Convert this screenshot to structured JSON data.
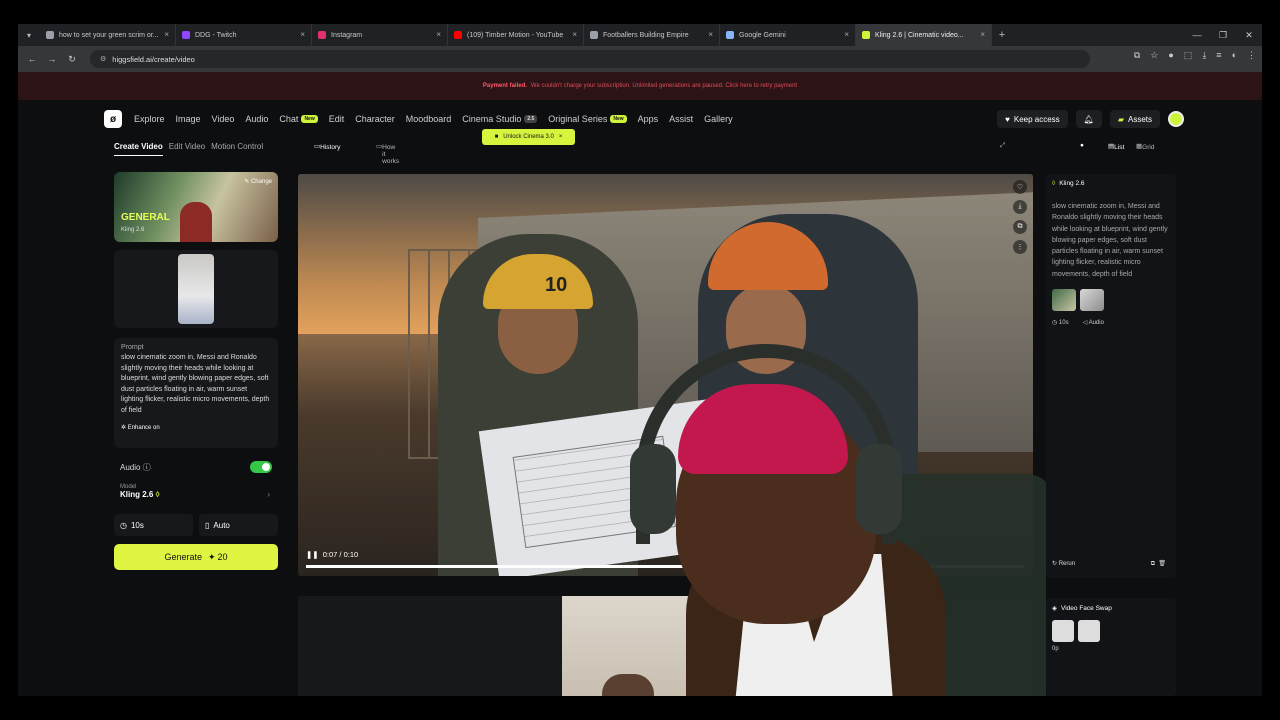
{
  "browser": {
    "tabs": [
      {
        "title": "how to set your green scrim or...",
        "color": "#9aa0a6"
      },
      {
        "title": "DDG - Twitch",
        "color": "#9146ff"
      },
      {
        "title": "Instagram",
        "color": "#e1306c"
      },
      {
        "title": "(109) Timber Motion - YouTube",
        "color": "#ff0000"
      },
      {
        "title": "Footballers Building Empire",
        "color": "#9aa0a6"
      },
      {
        "title": "Google Gemini",
        "color": "#8ab4f8"
      },
      {
        "title": "Kling 2.6 | Cinematic video...",
        "color": "#cdf33b",
        "active": true
      }
    ],
    "url": "higgsfield.ai/create/video"
  },
  "banner": {
    "bold": "Payment failed.",
    "text": "We couldn't charge your subscription. Unlimited generations are paused. Click here to retry payment"
  },
  "nav": {
    "items": [
      "Explore",
      "Image",
      "Video",
      "Audio",
      "Chat",
      "Edit",
      "Character",
      "Moodboard",
      "Cinema Studio",
      "Original Series",
      "Apps",
      "Assist",
      "Gallery"
    ],
    "chat_badge": "New",
    "cinema_badge": "2.5",
    "series_badge": "New",
    "keep_access": "Keep access",
    "assets": "Assets",
    "unlock": "Unlock Cinema 3.0",
    "accent": "#cdf33b"
  },
  "left": {
    "tabs": [
      "Create Video",
      "Edit Video",
      "Motion Control"
    ],
    "model_card": {
      "title": "GENERAL",
      "sub": "Kling 2.6",
      "change": "Change"
    },
    "prompt_label": "Prompt",
    "prompt": "slow cinematic zoom in, Messi and Ronaldo slightly moving their heads while looking at blueprint, wind gently blowing paper edges, soft dust particles floating in air, warm sunset lighting flicker, realistic micro movements, depth of field",
    "enhance": "Enhance on",
    "audio_label": "Audio",
    "model_label": "Model",
    "model_value": "Kling 2.6",
    "duration": "10s",
    "aspect": "Auto",
    "generate": "Generate",
    "cost": "20"
  },
  "center": {
    "history": "History",
    "how_it_works": "How it works",
    "list": "List",
    "grid": "Grid",
    "time": "0:07 / 0:10",
    "progress": 0.7,
    "helmet_number": "10"
  },
  "right": {
    "model": "Kling 2.6",
    "prompt": "slow cinematic zoom in, Messi and Ronaldo slightly moving their heads while looking at blueprint, wind gently blowing paper edges, soft dust particles floating in air, warm sunset lighting flicker, realistic micro movements, depth of field",
    "duration": "10s",
    "audio": "Audio",
    "rerun": "Rerun",
    "second_title": "Video Face Swap",
    "second_meta": "0p"
  }
}
